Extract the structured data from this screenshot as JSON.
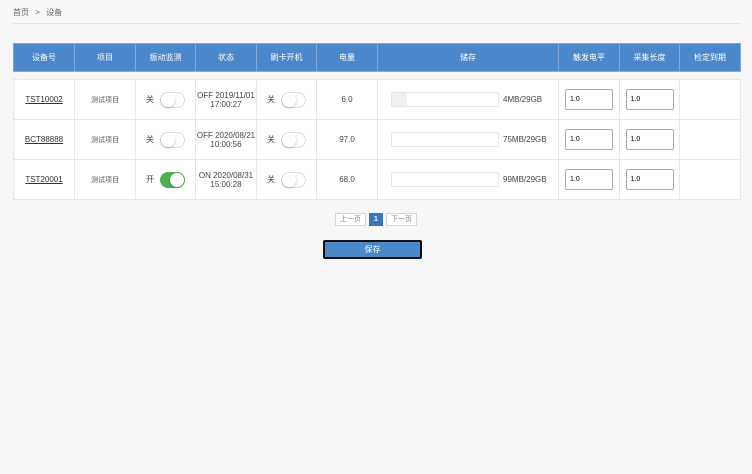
{
  "breadcrumb": {
    "home": "首页",
    "separator": ">",
    "current": "设备"
  },
  "table": {
    "headers": [
      "设备号",
      "项目",
      "振动监测",
      "状态",
      "刷卡开机",
      "电量",
      "储存",
      "触发电平",
      "采集长度",
      "检定到期"
    ],
    "rows": [
      {
        "device": "TST10002",
        "project": "测试项目",
        "vibration": {
          "label": "关",
          "on": false
        },
        "status": {
          "line1": "OFF 2019/11/01",
          "line2": "17:00:27"
        },
        "card": {
          "label": "关",
          "on": false
        },
        "power": "6.0",
        "storage": {
          "text": "4MB/29GB",
          "fraction": 0.14
        },
        "trigger": "1.0",
        "length": "1.0",
        "expiry": ""
      },
      {
        "device": "BCT88888",
        "project": "测试项目",
        "vibration": {
          "label": "关",
          "on": false
        },
        "status": {
          "line1": "OFF 2020/08/21",
          "line2": "10:00:56"
        },
        "card": {
          "label": "关",
          "on": false
        },
        "power": "97.0",
        "storage": {
          "text": "75MB/29GB",
          "fraction": 0.0
        },
        "trigger": "1.0",
        "length": "1.0",
        "expiry": ""
      },
      {
        "device": "TST20001",
        "project": "测试项目",
        "vibration": {
          "label": "开",
          "on": true
        },
        "status": {
          "line1": "ON 2020/08/31",
          "line2": "15:00:28"
        },
        "card": {
          "label": "关",
          "on": false
        },
        "power": "68.0",
        "storage": {
          "text": "99MB/29GB",
          "fraction": 0.0
        },
        "trigger": "1.0",
        "length": "1.0",
        "expiry": ""
      }
    ]
  },
  "pager": {
    "prev": "上一页",
    "current": "1",
    "next": "下一页"
  },
  "save_label": "保存",
  "colors": {
    "header": "#4a88cb",
    "switch_on": "#4caf50",
    "page_active": "#3a76c0"
  }
}
